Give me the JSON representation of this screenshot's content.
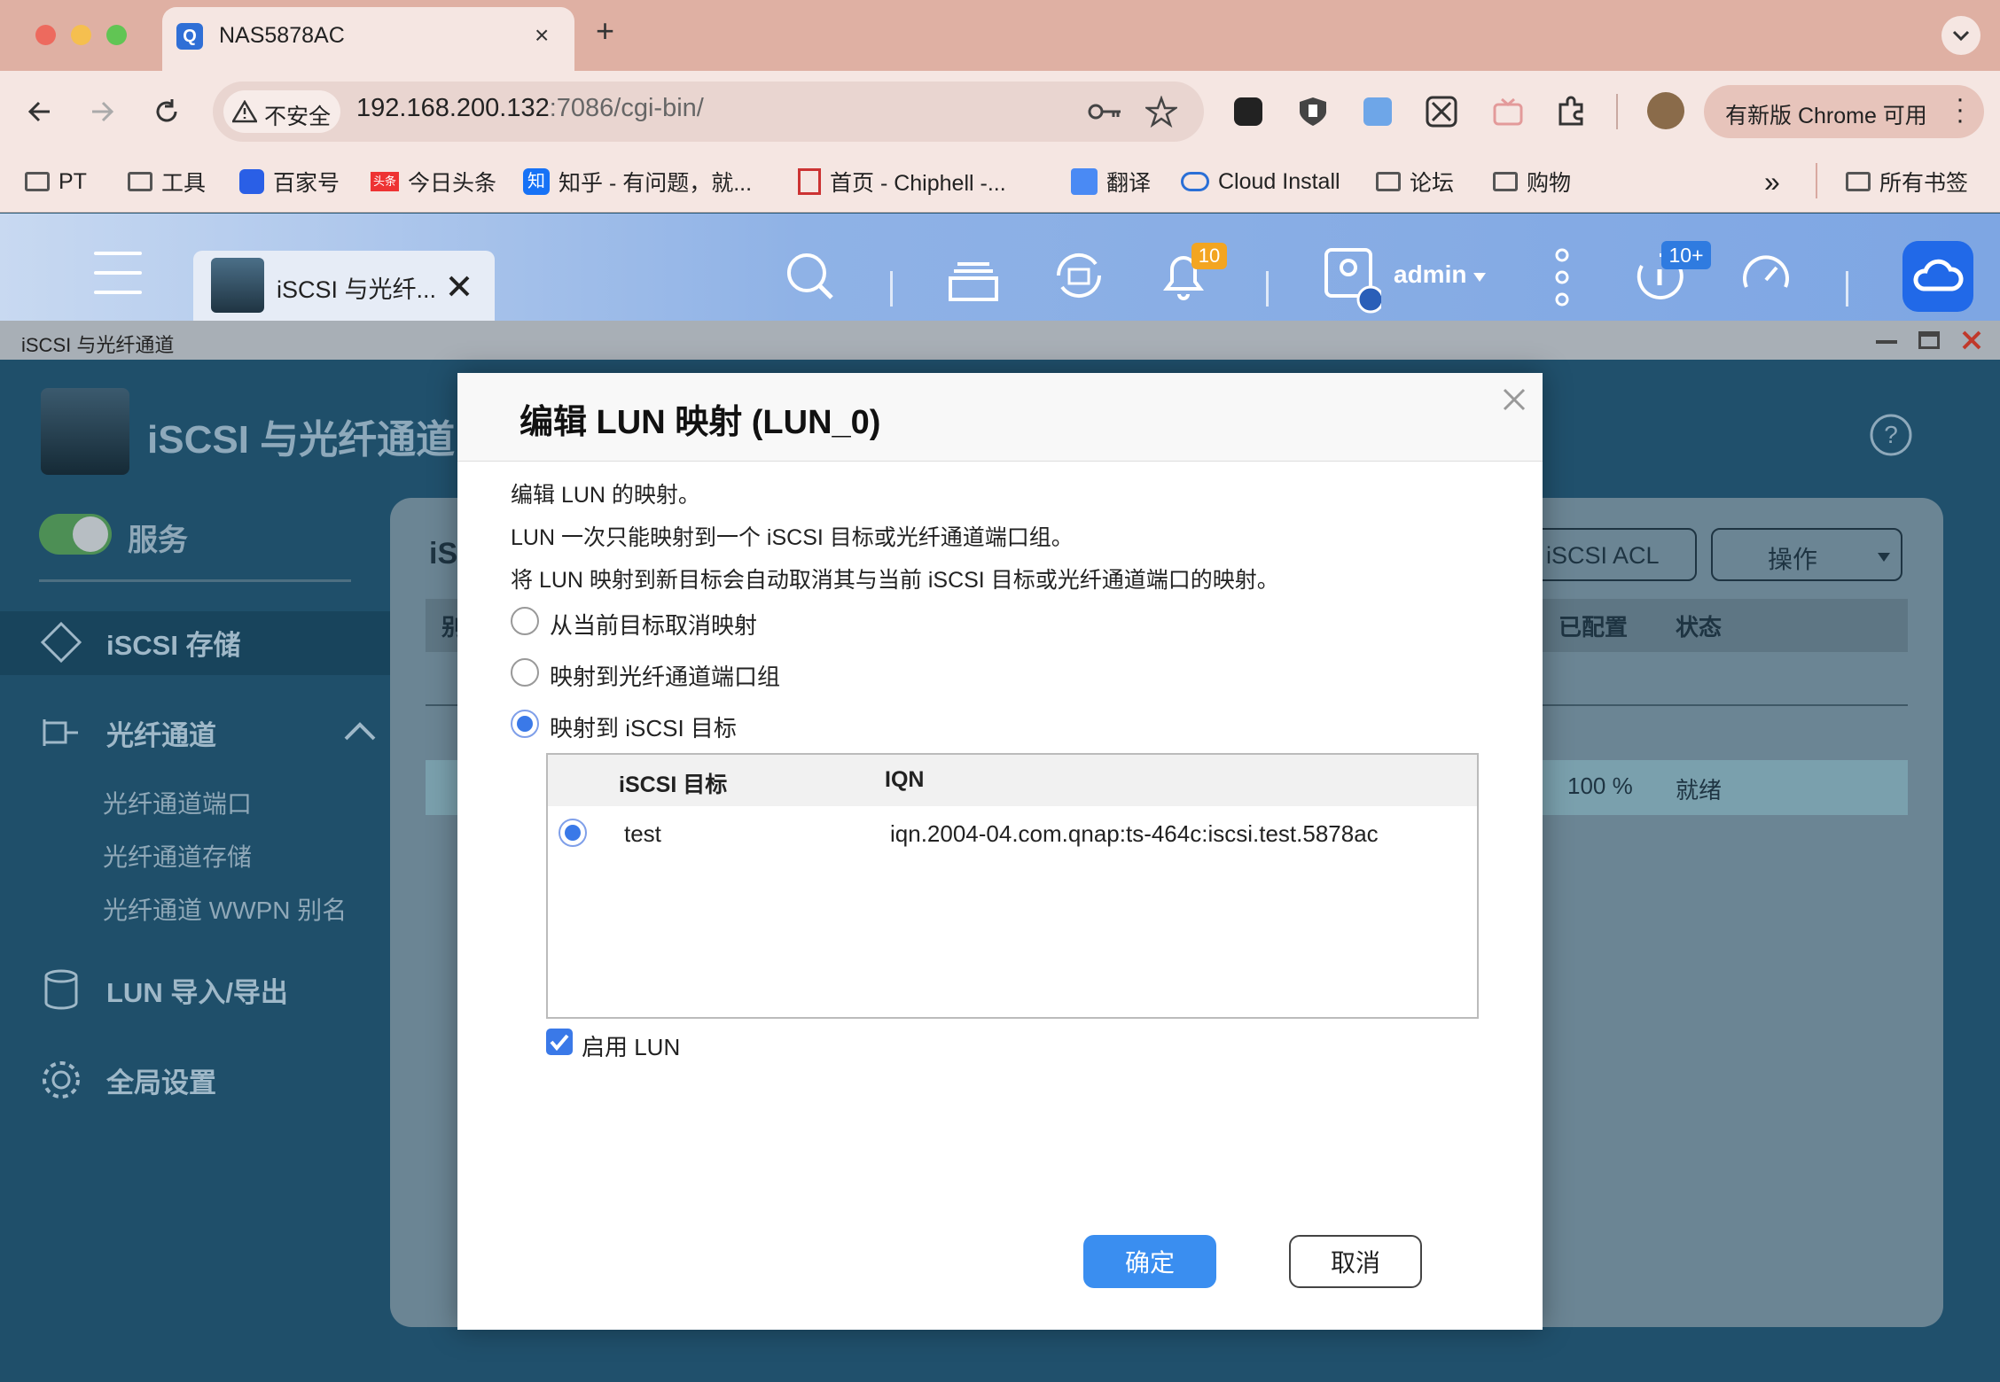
{
  "browser": {
    "tab_title": "NAS5878AC",
    "new_tab": "+",
    "security_label": "不安全",
    "url_host": "192.168.200.132",
    "url_rest": ":7086/cgi-bin/",
    "update_label": "有新版 Chrome 可用",
    "bookmarks": [
      "PT",
      "工具",
      "百家号",
      "今日头条",
      "知乎 - 有问题，就...",
      "首页 - Chiphell -...",
      "翻译",
      "Cloud Install",
      "论坛",
      "购物"
    ],
    "overflow": "»",
    "all_bookmarks": "所有书签",
    "badge_toutiao": "头条",
    "badge_zhihu": "知"
  },
  "qts": {
    "app_tab": "iSCSI 与光纤...",
    "user": "admin",
    "notif_count": "10",
    "tasks_count": "10+",
    "window_title": "iSCSI 与光纤通道"
  },
  "app": {
    "title": "iSCSI 与光纤通道",
    "service": "服务",
    "nav": {
      "iscsi_storage": "iSCSI 存储",
      "fc": "光纤通道",
      "fc_ports": "光纤通道端口",
      "fc_storage": "光纤通道存储",
      "fc_wwpn": "光纤通道 WWPN 别名",
      "lun_io": "LUN 导入/导出",
      "global": "全局设置"
    },
    "panel_heading_partial": "iS",
    "col_first_partial": "别",
    "btn_acl": "iSCSI ACL",
    "btn_ops": "操作",
    "col_allocated": "已配置",
    "col_status": "状态",
    "row_percent": "100 %",
    "row_status": "就绪"
  },
  "dialog": {
    "title": "编辑 LUN 映射 (LUN_0)",
    "line1": "编辑 LUN 的映射。",
    "line2": "LUN 一次只能映射到一个 iSCSI 目标或光纤通道端口组。",
    "line3": "将 LUN 映射到新目标会自动取消其与当前 iSCSI 目标或光纤通道端口的映射。",
    "opt_unmap": "从当前目标取消映射",
    "opt_fc": "映射到光纤通道端口组",
    "opt_iscsi": "映射到 iSCSI 目标",
    "table": {
      "headers": [
        "iSCSI 目标",
        "IQN"
      ],
      "rows": [
        {
          "target": "test",
          "iqn": "iqn.2004-04.com.qnap:ts-464c:iscsi.test.5878ac"
        }
      ]
    },
    "enable_lun": "启用 LUN",
    "ok": "确定",
    "cancel": "取消"
  },
  "colors": {
    "primary": "#3a79e8",
    "app_bg": "#20506c",
    "qts_bar": "#8fb2e6"
  }
}
